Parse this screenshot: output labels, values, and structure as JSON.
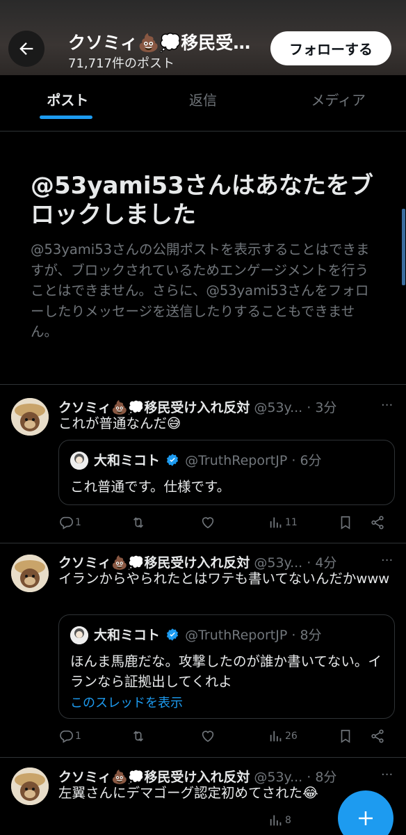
{
  "header": {
    "title": "クソミィ💩💭移民受…",
    "post_count": "71,717件のポスト",
    "follow_label": "フォローする"
  },
  "tabs": [
    {
      "label": "ポスト",
      "active": true
    },
    {
      "label": "返信",
      "active": false
    },
    {
      "label": "メディア",
      "active": false
    }
  ],
  "block_notice": {
    "title": "@53yami53さんはあなたをブロックしました",
    "description": "@53yami53さんの公開ポストを表示することはできますが、ブロックされているためエンゲージメントを行うことはできません。さらに、@53yami53さんをフォローしたりメッセージを送信したりすることもできません。"
  },
  "posts": [
    {
      "name": "クソミィ💩💭移民受け入れ反対",
      "handle": "@53y...",
      "time": "· 3分",
      "text": "これが普通なんだ😅",
      "quote": {
        "name": "大和ミコト",
        "handle": "@TruthReportJP",
        "time": "· 6分",
        "text": "これ普通です。仕様です。",
        "link": ""
      },
      "replies": "1",
      "reposts": "",
      "likes": "",
      "views": "11"
    },
    {
      "name": "クソミィ💩💭移民受け入れ反対",
      "handle": "@53y...",
      "time": "· 4分",
      "text": "イランからやられたとはワテも書いてないんだかwww",
      "quote": {
        "name": "大和ミコト",
        "handle": "@TruthReportJP",
        "time": "· 8分",
        "text": "ほんま馬鹿だな。攻撃したのが誰か書いてない。イランなら証拠出してくれよ",
        "link": "このスレッドを表示"
      },
      "replies": "1",
      "reposts": "",
      "likes": "",
      "views": "26"
    },
    {
      "name": "クソミィ💩💭移民受け入れ反対",
      "handle": "@53y...",
      "time": "· 8分",
      "text": "左翼さんにデマゴーグ認定初めてされた😂",
      "views": "8"
    }
  ],
  "icons": {
    "back": "arrow-left-icon",
    "more": "more-dots-icon",
    "reply": "reply-icon",
    "repost": "repost-icon",
    "like": "heart-icon",
    "views": "views-icon",
    "bookmark": "bookmark-icon",
    "share": "share-icon",
    "compose": "plus-icon",
    "verified": "verified-badge-icon"
  },
  "colors": {
    "accent": "#1d9bf0",
    "background": "#000000",
    "muted": "#71767b"
  }
}
